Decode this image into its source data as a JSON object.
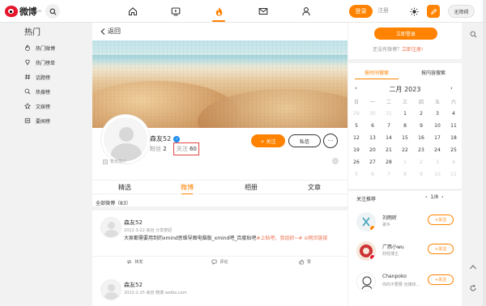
{
  "brand": {
    "logo_text": "微博",
    "logo_sub": "weibo.com"
  },
  "topbar": {
    "nav": [
      "home-icon",
      "video-icon",
      "hot-icon",
      "mail-icon",
      "user-icon"
    ],
    "login_label": "登录",
    "register_label": "注册",
    "barrier_label": "无障碍",
    "accent": "#ff8200"
  },
  "sidebar": {
    "title": "热门",
    "items": [
      {
        "label": "热门微博",
        "icon": "fire-icon"
      },
      {
        "label": "热门榜单",
        "icon": "list-icon"
      },
      {
        "label": "话题榜",
        "icon": "hashtag-icon"
      },
      {
        "label": "热搜榜",
        "icon": "search-trend-icon"
      },
      {
        "label": "文娱榜",
        "icon": "star-icon"
      },
      {
        "label": "要闻榜",
        "icon": "news-icon"
      }
    ]
  },
  "profile": {
    "back_label": "返回",
    "name": "森友52",
    "fans_label": "粉丝",
    "fans_count": "2",
    "follow_label": "关注",
    "follow_count": "60",
    "intro": "暂无简介",
    "follow_button": "+ 关注",
    "message_button": "私信",
    "more_button": "···"
  },
  "tabs": [
    "精选",
    "微博",
    "相册",
    "文章"
  ],
  "active_tab": "微博",
  "feed": {
    "header": "全部微博（83）",
    "posts": [
      {
        "name": "森友52",
        "meta": "2022-3-22 来自 分享按钮",
        "text": "大家都需要用到的xmind思维导图电脑版_xmind吧_百度贴吧",
        "tag_text": "#上贴吧，我组织~# ⊘网页链接",
        "repost": "转发",
        "comment": "评论",
        "like": "赞"
      },
      {
        "name": "森友52",
        "meta": "2022-2-25 来自 微博 weibo.com",
        "text": "",
        "tag_text": "",
        "repost": "",
        "comment": "",
        "like": ""
      }
    ]
  },
  "right": {
    "login_button": "立即登录",
    "no_account": "还没有微博？",
    "register_link": "立即注册!",
    "cal_tabs": [
      "按时间搜索",
      "按内容搜索"
    ],
    "month": "二月 2023",
    "weekdays": [
      "日",
      "一",
      "二",
      "三",
      "四",
      "五",
      "六"
    ],
    "days": [
      [
        "29",
        "30",
        "31",
        "1",
        "2",
        "3",
        "4"
      ],
      [
        "5",
        "6",
        "7",
        "8",
        "9",
        "10",
        "11"
      ],
      [
        "12",
        "13",
        "14",
        "15",
        "16",
        "17",
        "18"
      ],
      [
        "19",
        "20",
        "21",
        "22",
        "23",
        "24",
        "25"
      ],
      [
        "26",
        "27",
        "28",
        "1",
        "2",
        "3",
        "4"
      ],
      [
        "5",
        "6",
        "7",
        "8",
        "9",
        "10",
        "11"
      ]
    ],
    "rec_title": "关注推荐",
    "rec_pager": "1/8",
    "recommendations": [
      {
        "name": "刘雨昕",
        "desc": "歌手",
        "follow": "+关注"
      },
      {
        "name": "广西小wu",
        "desc": "财经博主",
        "follow": "+关注"
      },
      {
        "name": "Chanpoko",
        "desc": "你的不要要 自媒体...",
        "follow": "+关注"
      }
    ]
  }
}
